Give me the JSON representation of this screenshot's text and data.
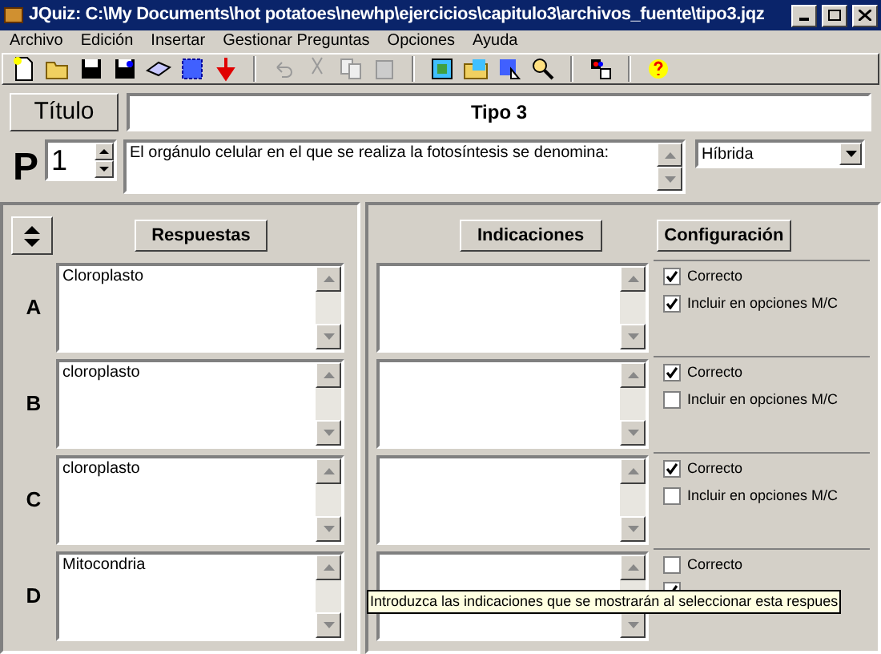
{
  "window": {
    "title": "JQuiz: C:\\My Documents\\hot potatoes\\newhp\\ejercicios\\capitulo3\\archivos_fuente\\tipo3.jqz"
  },
  "menu": [
    "Archivo",
    "Edición",
    "Insertar",
    "Gestionar Preguntas",
    "Opciones",
    "Ayuda"
  ],
  "title_button": "Título",
  "title_value": "Tipo 3",
  "question": {
    "label": "P",
    "number": "1",
    "text": "El orgánulo celular en el que se realiza la fotosíntesis se denomina:",
    "type": "Híbrida"
  },
  "headers": {
    "answers": "Respuestas",
    "hints": "Indicaciones",
    "settings": "Configuración"
  },
  "answers": [
    {
      "letter": "A",
      "text": "Cloroplasto",
      "options": [
        {
          "label": "Correcto",
          "checked": true
        },
        {
          "label": "Incluir en opciones M/C",
          "checked": true
        }
      ]
    },
    {
      "letter": "B",
      "text": "cloroplasto",
      "options": [
        {
          "label": "Correcto",
          "checked": true
        },
        {
          "label": "Incluir en opciones M/C",
          "checked": false
        }
      ]
    },
    {
      "letter": "C",
      "text": "cloroplasto",
      "options": [
        {
          "label": "Correcto",
          "checked": true
        },
        {
          "label": "Incluir en opciones M/C",
          "checked": false
        }
      ]
    },
    {
      "letter": "D",
      "text": "Mitocondria",
      "options": [
        {
          "label": "Correcto",
          "checked": false
        },
        {
          "checked": true
        }
      ]
    }
  ],
  "tooltip": "Introduzca las indicaciones que se mostrarán al seleccionar esta respues"
}
